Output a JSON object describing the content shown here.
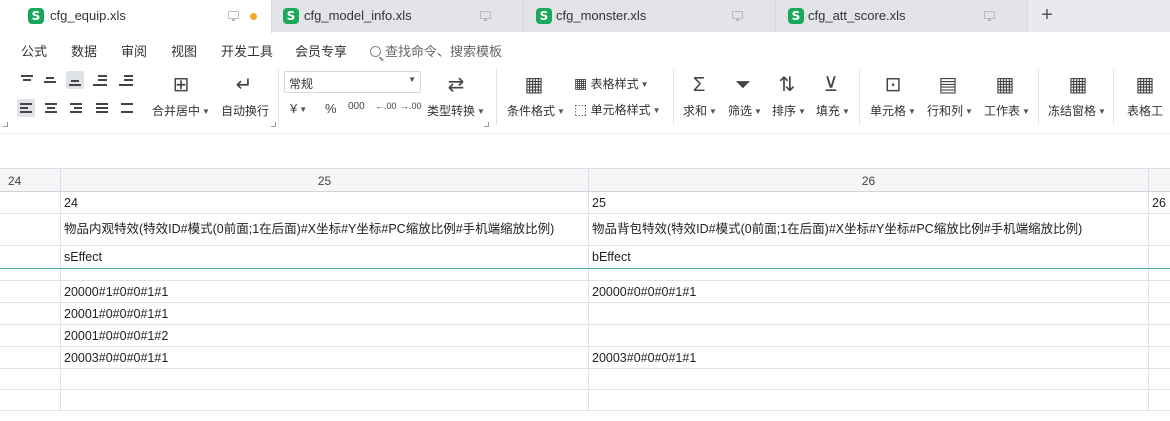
{
  "tabs": [
    {
      "name": "cfg_equip.xls",
      "active": true,
      "modified": true
    },
    {
      "name": "cfg_model_info.xls",
      "active": false,
      "modified": false
    },
    {
      "name": "cfg_monster.xls",
      "active": false,
      "modified": false
    },
    {
      "name": "cfg_att_score.xls",
      "active": false,
      "modified": false
    }
  ],
  "tab_icon_letter": "S",
  "new_tab_label": "+",
  "menu": [
    "公式",
    "数据",
    "审阅",
    "视图",
    "开发工具",
    "会员专享"
  ],
  "search_placeholder": "查找命令、搜索模板",
  "ribbon": {
    "merge_center": "合并居中",
    "wrap_text": "自动换行",
    "number_format": "常规",
    "currency_symbol": "¥",
    "percent_symbol": "%",
    "thousands_symbol": "000",
    "inc_decimal": ".00",
    "dec_decimal": ".00",
    "type_convert": "类型转换",
    "conditional_format": "条件格式",
    "table_style": "表格样式",
    "cell_style": "单元格样式",
    "sum": "求和",
    "filter": "筛选",
    "sort": "排序",
    "fill": "填充",
    "cell": "单元格",
    "row_col": "行和列",
    "worksheet": "工作表",
    "freeze": "冻结窗格",
    "table_tools": "表格工"
  },
  "sheet": {
    "column_headers": [
      "24",
      "25",
      "26"
    ],
    "rows": [
      [
        "",
        "24",
        "25",
        "26"
      ],
      [
        "",
        "物品内观特效(特效ID#模式(0前面;1在后面)#X坐标#Y坐标#PC缩放比例#手机端缩放比例)",
        "物品背包特效(特效ID#模式(0前面;1在后面)#X坐标#Y坐标#PC缩放比例#手机端缩放比例)",
        ""
      ],
      [
        "",
        "sEffect",
        "bEffect",
        ""
      ],
      [
        "",
        "",
        "",
        ""
      ],
      [
        "",
        "20000#1#0#0#1#1",
        "20000#0#0#0#1#1",
        ""
      ],
      [
        "",
        "20001#0#0#0#1#1",
        "",
        ""
      ],
      [
        "",
        "20001#0#0#0#1#2",
        "",
        ""
      ],
      [
        "",
        "20003#0#0#0#1#1",
        "20003#0#0#0#1#1",
        ""
      ],
      [
        "",
        "",
        "",
        ""
      ],
      [
        "",
        "",
        "",
        ""
      ]
    ]
  }
}
